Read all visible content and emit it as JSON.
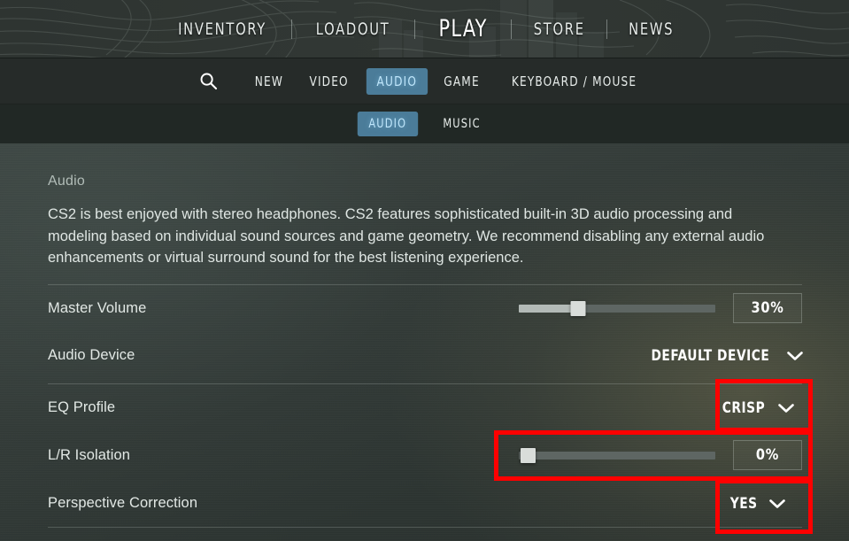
{
  "topnav": {
    "items": [
      {
        "label": "INVENTORY",
        "active": false
      },
      {
        "label": "LOADOUT",
        "active": false
      },
      {
        "label": "PLAY",
        "active": true
      },
      {
        "label": "STORE",
        "active": false
      },
      {
        "label": "NEWS",
        "active": false
      }
    ]
  },
  "settings_tabs": {
    "search_icon": "search-icon",
    "items": [
      {
        "label": "NEW",
        "active": false
      },
      {
        "label": "VIDEO",
        "active": false
      },
      {
        "label": "AUDIO",
        "active": true
      },
      {
        "label": "GAME",
        "active": false
      },
      {
        "label": "KEYBOARD / MOUSE",
        "active": false
      }
    ]
  },
  "sub_tabs": {
    "items": [
      {
        "label": "AUDIO",
        "active": true
      },
      {
        "label": "MUSIC",
        "active": false
      }
    ]
  },
  "section": {
    "title": "Audio",
    "description": "CS2 is best enjoyed with stereo headphones. CS2 features sophisticated built-in 3D audio processing and modeling based on individual sound sources and game geometry. We recommend disabling any external audio enhancements or virtual surround sound for the best listening experience."
  },
  "settings": [
    {
      "name": "master-volume",
      "label": "Master Volume",
      "control": "slider",
      "value": "30%",
      "percent": 30,
      "highlighted": false
    },
    {
      "name": "audio-device",
      "label": "Audio Device",
      "control": "dropdown",
      "value": "DEFAULT DEVICE",
      "highlighted": false
    },
    {
      "name": "eq-profile",
      "label": "EQ Profile",
      "control": "dropdown",
      "value": "CRISP",
      "highlighted": true
    },
    {
      "name": "lr-isolation",
      "label": "L/R Isolation",
      "control": "slider",
      "value": "0%",
      "percent": 0,
      "highlighted": true
    },
    {
      "name": "perspective-correction",
      "label": "Perspective Correction",
      "control": "dropdown",
      "value": "YES",
      "highlighted": true
    }
  ],
  "icons": {
    "chevron_down": "chevron-down-icon",
    "search": "search-icon"
  },
  "colors": {
    "accent_tab_bg": "#4b7c99",
    "accent_tab_text": "#bfe6fb",
    "annotation": "#ff0000",
    "text_primary": "#e2e8e5",
    "panel_bg": "#333b38"
  }
}
